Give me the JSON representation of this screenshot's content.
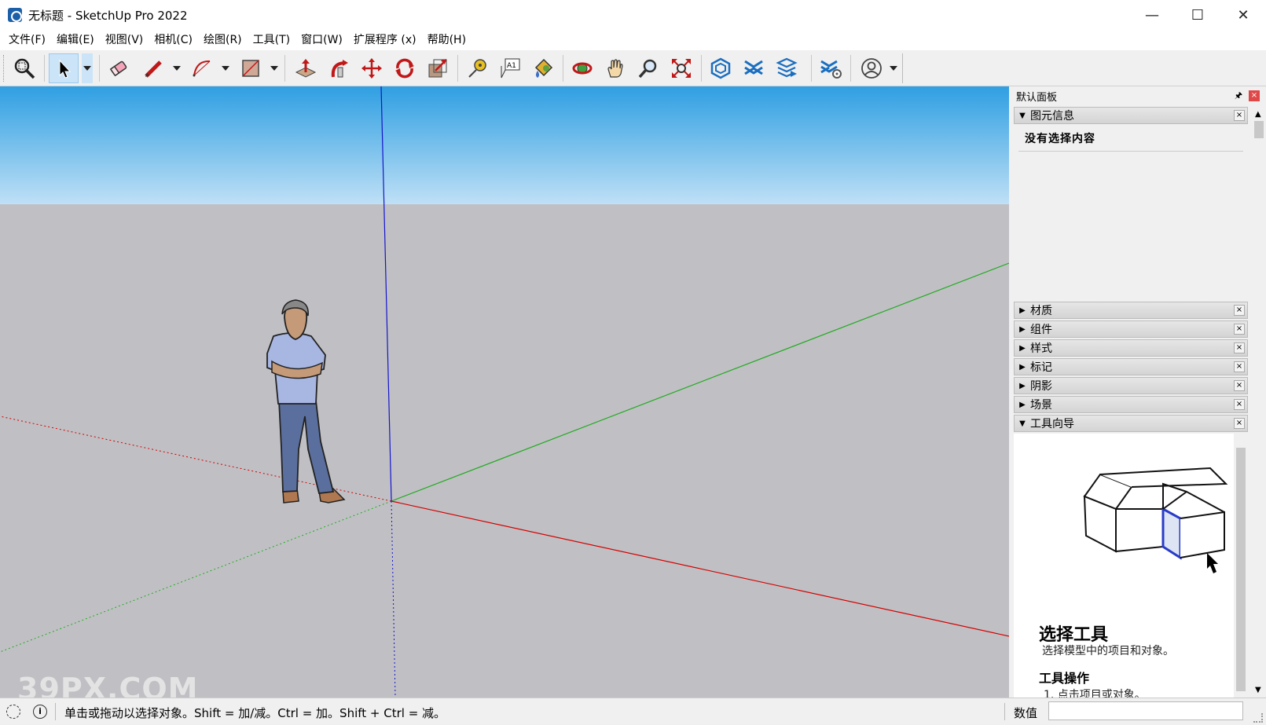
{
  "window": {
    "title": "无标题 - SketchUp Pro 2022",
    "minimize": "—",
    "maximize": "☐",
    "close": "✕"
  },
  "menu": [
    "文件(F)",
    "编辑(E)",
    "视图(V)",
    "相机(C)",
    "绘图(R)",
    "工具(T)",
    "窗口(W)",
    "扩展程序 (x)",
    "帮助(H)"
  ],
  "toolbar": {
    "tools": [
      "zoom-window",
      "select",
      "eraser",
      "pencil",
      "arc",
      "rectangle",
      "push-pull",
      "follow-me",
      "move",
      "rotate",
      "scale",
      "tape-measure",
      "text",
      "paint-bucket",
      "orbit",
      "pan",
      "zoom",
      "zoom-extents",
      "warehouse",
      "extension-warehouse",
      "layout",
      "extension-manager",
      "account"
    ],
    "active_tool": "select"
  },
  "viewport": {
    "watermark": "39PX.COM",
    "sky_color": "#3aa6e6",
    "ground_color": "#c0c0c4",
    "axis_colors": {
      "red": "#d40000",
      "green": "#22aa22",
      "blue": "#1414cc"
    }
  },
  "tray": {
    "title": "默认面板",
    "pin": "🖈",
    "close": "×",
    "panels": [
      {
        "label": "图元信息",
        "expanded": true
      },
      {
        "label": "材质",
        "expanded": false
      },
      {
        "label": "组件",
        "expanded": false
      },
      {
        "label": "样式",
        "expanded": false
      },
      {
        "label": "标记",
        "expanded": false
      },
      {
        "label": "阴影",
        "expanded": false
      },
      {
        "label": "场景",
        "expanded": false
      },
      {
        "label": "工具向导",
        "expanded": true
      }
    ],
    "entity_info": {
      "status": "没有选择内容"
    },
    "instructor": {
      "title": "选择工具",
      "description": "选择模型中的项目和对象。",
      "operations_heading": "工具操作",
      "step1": "1. 点击项目或对象。"
    }
  },
  "statusbar": {
    "hint": "单击或拖动以选择对象。Shift = 加/减。Ctrl = 加。Shift + Ctrl = 减。",
    "measurements_label": "数值",
    "measurements_value": ""
  }
}
